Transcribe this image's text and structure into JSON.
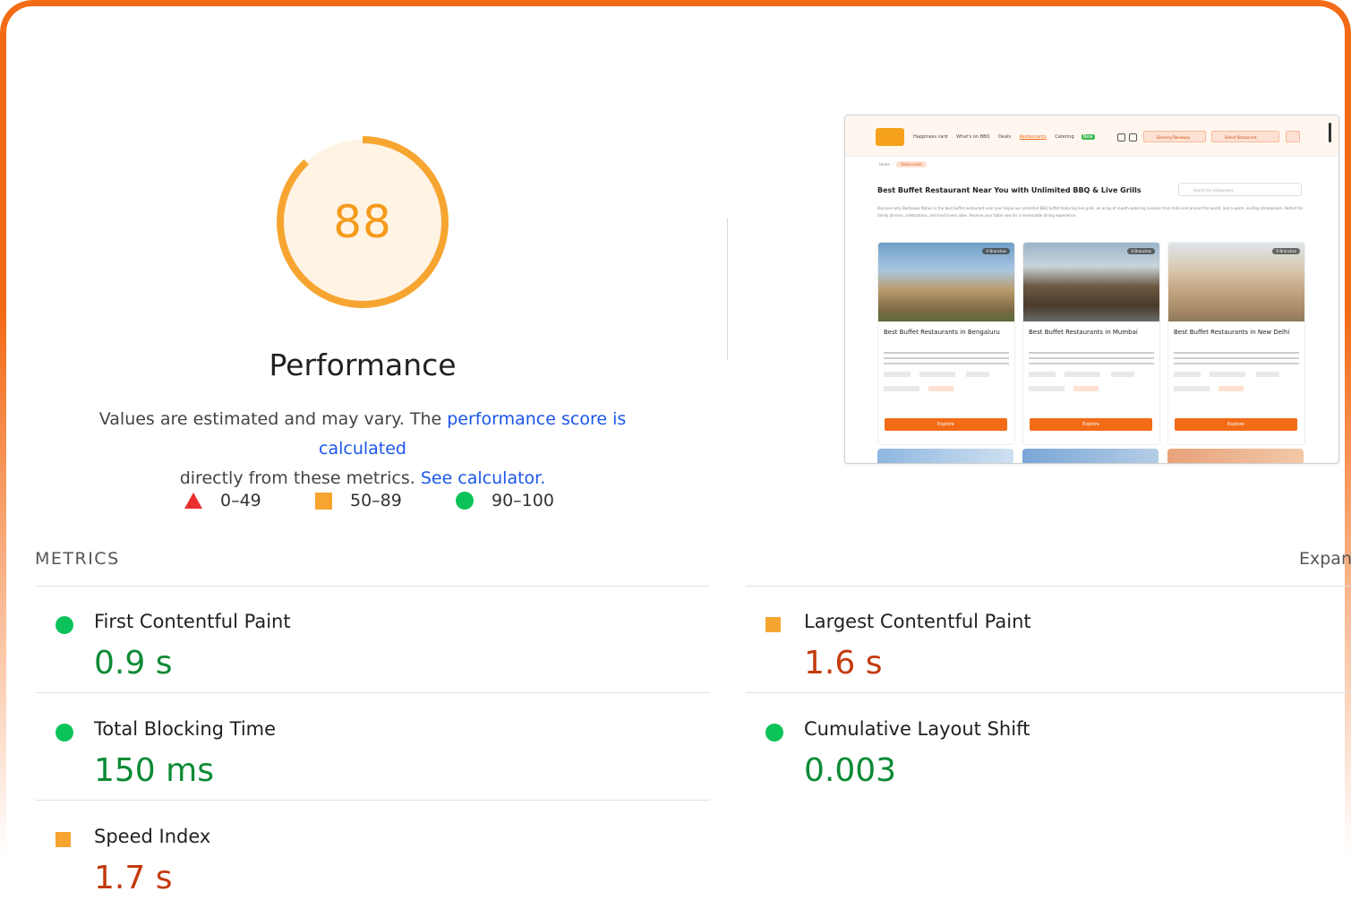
{
  "score": {
    "value": "88",
    "fraction": 0.88,
    "color": "#f59b1b",
    "track_color": "#fff3e4"
  },
  "title": "Performance",
  "description": {
    "prefix": "Values are estimated and may vary. The ",
    "link_score": "performance score is calculated",
    "middle": "directly from these metrics. ",
    "link_calculator": "See calculator."
  },
  "legend": [
    {
      "icon": "triangle-icon",
      "range": "0–49",
      "color": "#eb2f2f"
    },
    {
      "icon": "square-icon",
      "range": "50–89",
      "color": "#f7a531"
    },
    {
      "icon": "circle-icon",
      "range": "90–100",
      "color": "#0cc35a"
    }
  ],
  "screenshot": {
    "nav_links": [
      "Happiness card",
      "What's on BBQ",
      "Deals",
      "Restaurants",
      "Catering"
    ],
    "nav_badge": "New",
    "buttons": [
      "Delivery/Takeaway",
      "Select Restaurant"
    ],
    "breadcrumb": [
      "Home",
      "Restaurants"
    ],
    "heading": "Best Buffet Restaurant Near You with Unlimited BBQ & Live Grills",
    "search_placeholder": "Search for restaurants",
    "paragraph": "Discover why Barbeque Nation is the best buffet restaurant near you! Enjoy our unlimited BBQ buffet featuring live grills, an array of mouth-watering cuisines from India and around the world, and a warm, inviting atmosphere. Perfect for family dinners, celebrations, and food lovers alike. Reserve your table now for a memorable dining experience.",
    "cards": [
      {
        "title": "Best Buffet Restaurants in Bengaluru",
        "pill": "X Branches"
      },
      {
        "title": "Best Buffet Restaurants in Mumbai",
        "pill": "X Branches"
      },
      {
        "title": "Best Buffet Restaurants in New Delhi",
        "pill": "X Branches"
      }
    ],
    "explore_label": "Explore"
  },
  "metrics_title": "METRICS",
  "expand_label": "Expand view",
  "metrics": [
    {
      "label": "First Contentful Paint",
      "value": "0.9 s",
      "rating": "good"
    },
    {
      "label": "Largest Contentful Paint",
      "value": "1.6 s",
      "rating": "average"
    },
    {
      "label": "Total Blocking Time",
      "value": "150 ms",
      "rating": "good"
    },
    {
      "label": "Cumulative Layout Shift",
      "value": "0.003",
      "rating": "good"
    },
    {
      "label": "Speed Index",
      "value": "1.7 s",
      "rating": "average"
    }
  ],
  "colors": {
    "frame": "#f36b17",
    "link": "#1a56e8",
    "good_text": "#0b8a34",
    "average_text": "#c43a0c"
  }
}
